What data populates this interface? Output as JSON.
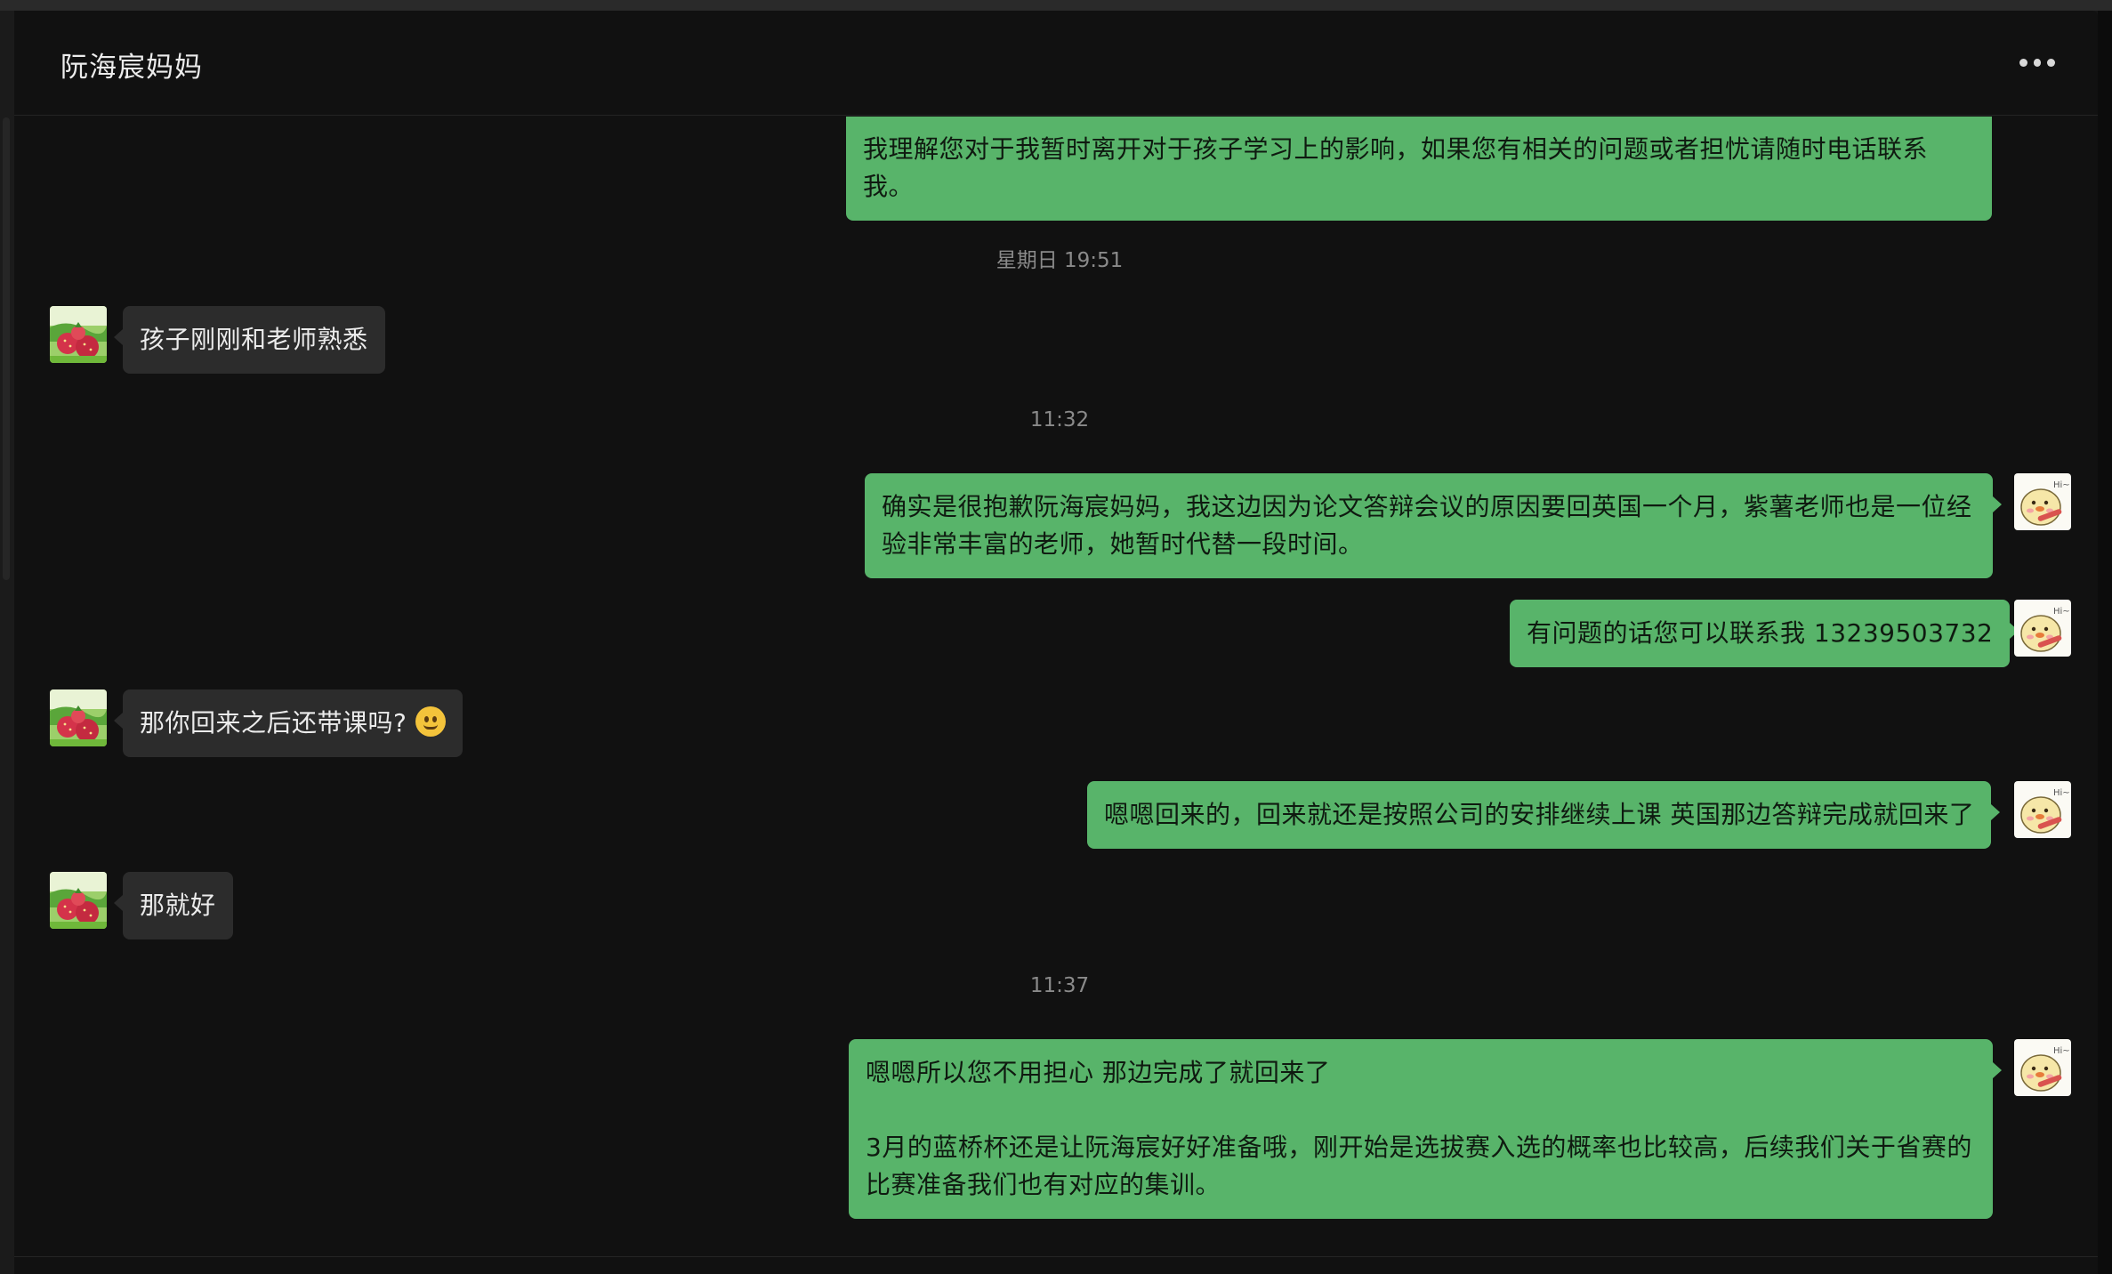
{
  "chat": {
    "title": "阮海宸妈妈",
    "more_icon": "more-horizontal-icon"
  },
  "messages": [
    {
      "id": "m0",
      "type": "out",
      "text": "我理解您对于我暂时离开对于孩子学习上的影响，如果您有相关的问题或者担忧请随时电话联系我。"
    },
    {
      "id": "t1",
      "type": "time",
      "text": "星期日 19:51"
    },
    {
      "id": "m1",
      "type": "in",
      "text": "孩子刚刚和老师熟悉"
    },
    {
      "id": "t2",
      "type": "time",
      "text": "11:32"
    },
    {
      "id": "m2",
      "type": "out",
      "text": "确实是很抱歉阮海宸妈妈，我这边因为论文答辩会议的原因要回英国一个月，紫薯老师也是一位经\n验非常丰富的老师，她暂时代替一段时间。"
    },
    {
      "id": "m3",
      "type": "out",
      "text": "有问题的话您可以联系我 13239503732"
    },
    {
      "id": "m4",
      "type": "in",
      "text": "那你回来之后还带课吗?",
      "emoji": "grinning-face-emoji"
    },
    {
      "id": "m5",
      "type": "out",
      "text": "嗯嗯回来的，回来就还是按照公司的安排继续上课 英国那边答辩完成就回来了"
    },
    {
      "id": "m6",
      "type": "in",
      "text": "那就好"
    },
    {
      "id": "t3",
      "type": "time",
      "text": "11:37"
    },
    {
      "id": "m7",
      "type": "out",
      "text": "嗯嗯所以您不用担心 那边完成了就回来了\n\n3月的蓝桥杯还是让阮海宸好好准备哦，刚开始是选拔赛入选的概率也比较高，后续我们关于省赛的\n比赛准备我们也有对应的集训。"
    }
  ],
  "avatars": {
    "contact": {
      "icon": "strawberry-avatar",
      "accent": "#6fb83a"
    },
    "self": {
      "icon": "cartoon-bird-avatar",
      "accent": "#f6e7a8",
      "text": "Hi~"
    }
  },
  "colors": {
    "background": "#111111",
    "outgoing_bubble": "#58b46a",
    "incoming_bubble": "#2c2c2c",
    "timestamp": "#8a8a8a"
  }
}
